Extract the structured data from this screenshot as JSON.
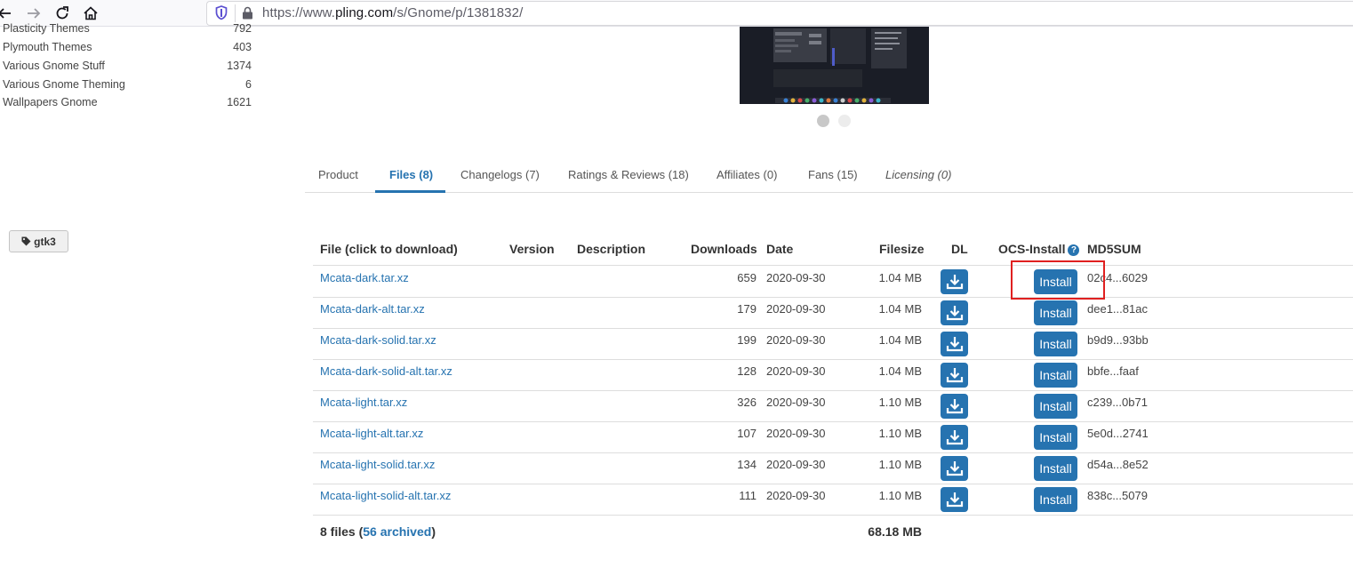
{
  "browser": {
    "url_prefix": "https://www.",
    "url_domain": "pling.com",
    "url_path": "/s/Gnome/p/1381832/"
  },
  "categories": [
    {
      "name": "Plymouth Themes",
      "count": "403"
    },
    {
      "name": "Various Gnome Stuff",
      "count": "1374"
    },
    {
      "name": "Various Gnome Theming",
      "count": "6"
    },
    {
      "name": "Wallpapers Gnome",
      "count": "1621"
    }
  ],
  "categories_partial": {
    "name": "Plasticity Themes",
    "count": "792"
  },
  "tabs": [
    {
      "label": "Product"
    },
    {
      "label": "Files (8)"
    },
    {
      "label": "Changelogs (7)"
    },
    {
      "label": "Ratings & Reviews (18)"
    },
    {
      "label": "Affiliates (0)"
    },
    {
      "label": "Fans (15)"
    },
    {
      "label": "Licensing (0)"
    }
  ],
  "tag": {
    "label": "gtk3"
  },
  "table": {
    "headers": {
      "file": "File (click to download)",
      "version": "Version",
      "description": "Description",
      "downloads": "Downloads",
      "date": "Date",
      "filesize": "Filesize",
      "dl": "DL",
      "ocs": "OCS-Install",
      "md5": "MD5SUM"
    },
    "install_label": "Install",
    "rows": [
      {
        "file": "Mcata-dark.tar.xz",
        "downloads": "659",
        "date": "2020-09-30",
        "size": "1.04 MB",
        "md5": "02c4...6029"
      },
      {
        "file": "Mcata-dark-alt.tar.xz",
        "downloads": "179",
        "date": "2020-09-30",
        "size": "1.04 MB",
        "md5": "dee1...81ac"
      },
      {
        "file": "Mcata-dark-solid.tar.xz",
        "downloads": "199",
        "date": "2020-09-30",
        "size": "1.04 MB",
        "md5": "b9d9...93bb"
      },
      {
        "file": "Mcata-dark-solid-alt.tar.xz",
        "downloads": "128",
        "date": "2020-09-30",
        "size": "1.04 MB",
        "md5": "bbfe...faaf"
      },
      {
        "file": "Mcata-light.tar.xz",
        "downloads": "326",
        "date": "2020-09-30",
        "size": "1.10 MB",
        "md5": "c239...0b71"
      },
      {
        "file": "Mcata-light-alt.tar.xz",
        "downloads": "107",
        "date": "2020-09-30",
        "size": "1.10 MB",
        "md5": "5e0d...2741"
      },
      {
        "file": "Mcata-light-solid.tar.xz",
        "downloads": "134",
        "date": "2020-09-30",
        "size": "1.10 MB",
        "md5": "d54a...8e52"
      },
      {
        "file": "Mcata-light-solid-alt.tar.xz",
        "downloads": "111",
        "date": "2020-09-30",
        "size": "1.10 MB",
        "md5": "838c...5079"
      }
    ],
    "footer": {
      "files_count": "8 files (",
      "archived": "56 archived",
      "close": ")",
      "total_size": "68.18 MB"
    }
  },
  "colors": {
    "accent": "#2673b0",
    "highlight": "#e02020"
  }
}
